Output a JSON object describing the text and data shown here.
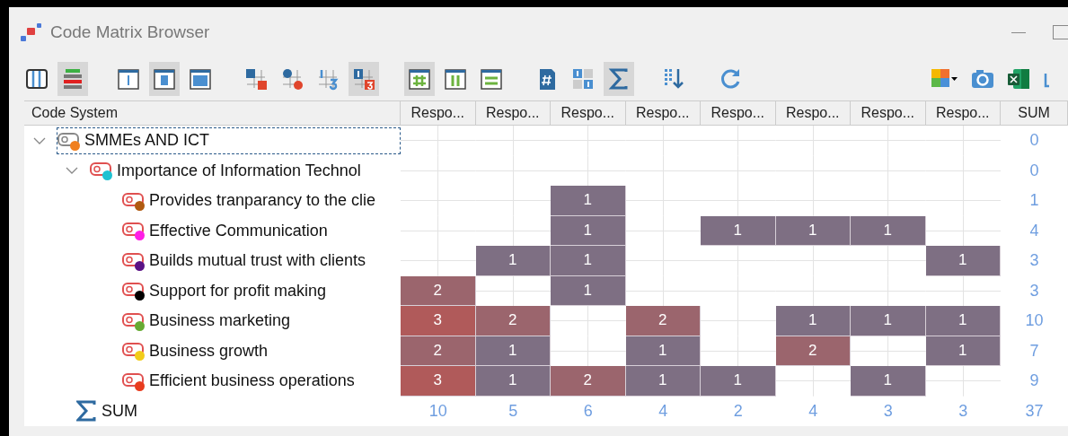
{
  "window": {
    "title": "Code Matrix Browser"
  },
  "toolbar": {
    "groups": [
      {
        "items": [
          {
            "kind": "columns",
            "selected": false
          },
          {
            "kind": "stacked-bars",
            "selected": true
          }
        ]
      },
      {
        "items": [
          {
            "kind": "frame-narrow",
            "selected": false
          },
          {
            "kind": "frame-mid",
            "selected": true
          },
          {
            "kind": "frame-wide",
            "selected": false
          }
        ]
      },
      {
        "items": [
          {
            "kind": "grid-square",
            "selected": false
          },
          {
            "kind": "grid-circle",
            "selected": false
          },
          {
            "kind": "grid-numbers",
            "selected": false
          },
          {
            "kind": "grid-badge",
            "selected": true
          }
        ]
      },
      {
        "items": [
          {
            "kind": "green-hash",
            "selected": true
          },
          {
            "kind": "green-columns",
            "selected": false
          },
          {
            "kind": "green-rows",
            "selected": false
          }
        ]
      },
      {
        "items": [
          {
            "kind": "hash-document",
            "selected": false
          },
          {
            "kind": "number-tiles",
            "selected": false
          },
          {
            "kind": "sigma",
            "selected": true
          }
        ]
      },
      {
        "items": [
          {
            "kind": "sort-down",
            "selected": false
          }
        ]
      },
      {
        "items": [
          {
            "kind": "refresh",
            "selected": false
          }
        ]
      }
    ],
    "right_items": [
      {
        "kind": "puzzle",
        "selected": false
      },
      {
        "kind": "camera",
        "selected": false
      },
      {
        "kind": "spreadsheet",
        "selected": false
      },
      {
        "kind": "export-arrow",
        "selected": false
      }
    ]
  },
  "table": {
    "columns": [
      "Code System",
      "Respo...",
      "Respo...",
      "Respo...",
      "Respo...",
      "Respo...",
      "Respo...",
      "Respo...",
      "Respo...",
      "SUM"
    ],
    "tree": [
      {
        "name": "SMMEs AND ICT",
        "color": "#f07f1e",
        "kind": "parent",
        "expanded": true,
        "selected": true,
        "cells": [
          {
            "filled": false
          },
          {
            "filled": false
          },
          {
            "filled": false
          },
          {
            "filled": false
          },
          {
            "filled": false
          },
          {
            "filled": false
          },
          {
            "filled": false
          },
          {
            "filled": false
          }
        ],
        "sum": "0",
        "children": [
          {
            "name": "Importance of Information Technol",
            "color": "#1ec2d2",
            "kind": "code",
            "expanded": true,
            "selected": false,
            "cells": [
              {
                "filled": false
              },
              {
                "filled": false
              },
              {
                "filled": false
              },
              {
                "filled": false
              },
              {
                "filled": false
              },
              {
                "filled": false
              },
              {
                "filled": false
              },
              {
                "filled": false
              }
            ],
            "sum": "0",
            "children": [
              {
                "name": "Provides tranparancy to the clie",
                "color": "#b05a10",
                "kind": "code",
                "selected": false,
                "cells": [
                  {
                    "filled": false
                  },
                  {
                    "filled": false
                  },
                  {
                    "filled": true,
                    "value": "1"
                  },
                  {
                    "filled": false
                  },
                  {
                    "filled": false
                  },
                  {
                    "filled": false
                  },
                  {
                    "filled": false
                  },
                  {
                    "filled": false
                  }
                ],
                "sum": "1"
              },
              {
                "name": "Effective Communication",
                "color": "#ff1ee6",
                "kind": "code",
                "selected": false,
                "cells": [
                  {
                    "filled": false
                  },
                  {
                    "filled": false
                  },
                  {
                    "filled": true,
                    "value": "1"
                  },
                  {
                    "filled": false
                  },
                  {
                    "filled": true,
                    "value": "1"
                  },
                  {
                    "filled": true,
                    "value": "1"
                  },
                  {
                    "filled": true,
                    "value": "1"
                  },
                  {
                    "filled": false
                  }
                ],
                "sum": "4"
              },
              {
                "name": "Builds mutual trust with clients",
                "color": "#5a1285",
                "kind": "code",
                "selected": false,
                "cells": [
                  {
                    "filled": false
                  },
                  {
                    "filled": true,
                    "value": "1"
                  },
                  {
                    "filled": true,
                    "value": "1"
                  },
                  {
                    "filled": false
                  },
                  {
                    "filled": false
                  },
                  {
                    "filled": false
                  },
                  {
                    "filled": false
                  },
                  {
                    "filled": true,
                    "value": "1"
                  }
                ],
                "sum": "3"
              },
              {
                "name": "Support for profit making",
                "color": "#000000",
                "kind": "code",
                "selected": false,
                "cells": [
                  {
                    "filled": true,
                    "value": "2"
                  },
                  {
                    "filled": false
                  },
                  {
                    "filled": true,
                    "value": "1"
                  },
                  {
                    "filled": false
                  },
                  {
                    "filled": false
                  },
                  {
                    "filled": false
                  },
                  {
                    "filled": false
                  },
                  {
                    "filled": false
                  }
                ],
                "sum": "3"
              },
              {
                "name": "Business marketing",
                "color": "#66aa33",
                "kind": "code",
                "selected": false,
                "cells": [
                  {
                    "filled": true,
                    "value": "3"
                  },
                  {
                    "filled": true,
                    "value": "2"
                  },
                  {
                    "filled": false
                  },
                  {
                    "filled": true,
                    "value": "2"
                  },
                  {
                    "filled": false
                  },
                  {
                    "filled": true,
                    "value": "1"
                  },
                  {
                    "filled": true,
                    "value": "1"
                  },
                  {
                    "filled": true,
                    "value": "1"
                  }
                ],
                "sum": "10"
              },
              {
                "name": "Business growth",
                "color": "#f2cc1a",
                "kind": "code",
                "selected": false,
                "cells": [
                  {
                    "filled": true,
                    "value": "2"
                  },
                  {
                    "filled": true,
                    "value": "1"
                  },
                  {
                    "filled": false
                  },
                  {
                    "filled": true,
                    "value": "1"
                  },
                  {
                    "filled": false
                  },
                  {
                    "filled": true,
                    "value": "2"
                  },
                  {
                    "filled": false
                  },
                  {
                    "filled": true,
                    "value": "1"
                  }
                ],
                "sum": "7"
              },
              {
                "name": "Efficient business operations",
                "color": "#e83c1e",
                "kind": "code",
                "selected": false,
                "cells": [
                  {
                    "filled": true,
                    "value": "3"
                  },
                  {
                    "filled": true,
                    "value": "1"
                  },
                  {
                    "filled": true,
                    "value": "2"
                  },
                  {
                    "filled": true,
                    "value": "1"
                  },
                  {
                    "filled": true,
                    "value": "1"
                  },
                  {
                    "filled": false
                  },
                  {
                    "filled": true,
                    "value": "1"
                  },
                  {
                    "filled": false
                  }
                ],
                "sum": "9"
              }
            ]
          }
        ]
      }
    ],
    "sum_row": {
      "label": "SUM",
      "values": [
        "10",
        "5",
        "6",
        "4",
        "2",
        "4",
        "3",
        "3"
      ],
      "sum": "37"
    }
  }
}
